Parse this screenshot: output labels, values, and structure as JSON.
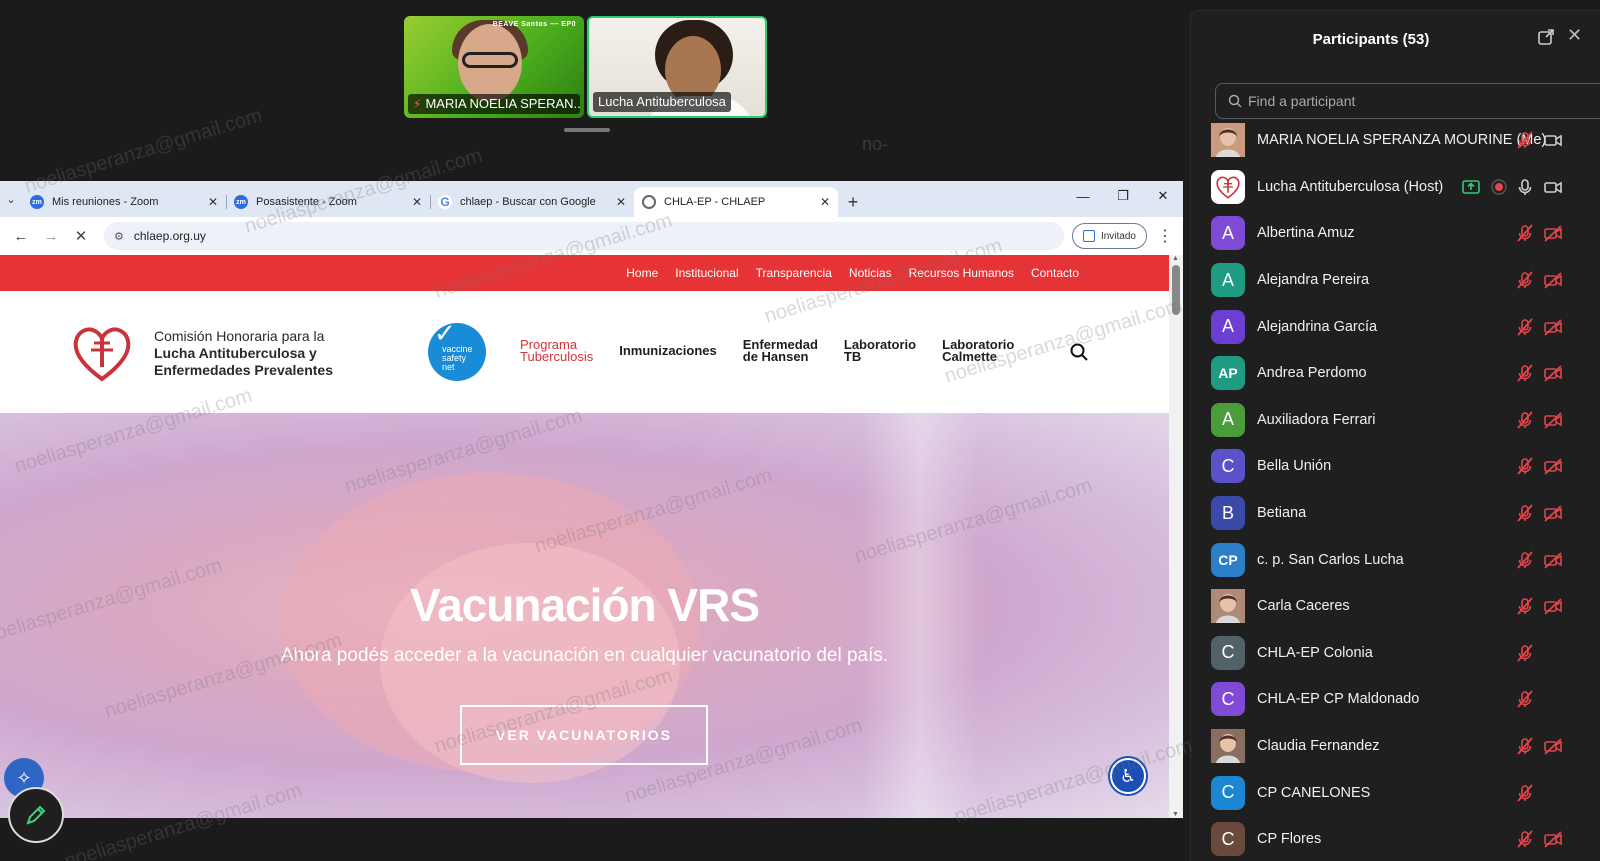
{
  "video_strip": {
    "tiles": [
      {
        "name": "MARIA NOELIA SPERAN...",
        "muted": true,
        "banner": "BEAVE Santos ‒‒ EP0"
      },
      {
        "name": "Lucha Antituberculosa",
        "muted": false
      }
    ]
  },
  "ghost_text": "no-",
  "browser": {
    "tabs": [
      {
        "title": "Mis reuniones - Zoom",
        "icon": "zoom-icon",
        "active": false
      },
      {
        "title": "Posasistente - Zoom",
        "icon": "zoom-icon",
        "active": false
      },
      {
        "title": "chlaep - Buscar con Google",
        "icon": "google-icon",
        "active": false
      },
      {
        "title": "CHLA-EP - CHLAEP",
        "icon": "site-icon",
        "active": true
      }
    ],
    "url": "chlaep.org.uy",
    "profile_label": "Invitado"
  },
  "site": {
    "topbar_links": [
      "Home",
      "Institucional",
      "Transparencia",
      "Noticias",
      "Recursos Humanos",
      "Contacto"
    ],
    "org_line1": "Comisión Honoraria para la",
    "org_line2": "Lucha Antituberculosa y",
    "org_line3": "Enfermedades Prevalentes",
    "vsn_badge": [
      "vaccine",
      "safety",
      "net"
    ],
    "nav": [
      {
        "label_1": "Programa",
        "label_2": "Tuberculosis",
        "highlight": true
      },
      {
        "label_1": "Inmunizaciones",
        "label_2": "",
        "highlight": false
      },
      {
        "label_1": "Enfermedad",
        "label_2": "de Hansen",
        "highlight": false
      },
      {
        "label_1": "Laboratorio",
        "label_2": "TB",
        "highlight": false
      },
      {
        "label_1": "Laboratorio",
        "label_2": "Calmette",
        "highlight": false
      }
    ],
    "hero": {
      "title": "Vacunación VRS",
      "subtitle": "Ahora podés acceder a la vacunación en cualquier vacunatorio del país.",
      "button": "VER VACUNATORIOS"
    }
  },
  "watermark": "noeliasperanza@gmail.com",
  "participants": {
    "title": "Participants (53)",
    "search_placeholder": "Find a participant",
    "list": [
      {
        "name": "MARIA NOELIA SPERANZA MOURINE (Me)",
        "initials": "",
        "color": "#c99a7e",
        "photo": true,
        "mic": "off",
        "video": "on",
        "share": false,
        "rec": false
      },
      {
        "name": "Lucha Antituberculosa (Host)",
        "initials": "",
        "color": "#ffffff",
        "photo": "logo",
        "mic": "on",
        "video": "on",
        "share": true,
        "rec": true
      },
      {
        "name": "Albertina Amuz",
        "initials": "A",
        "color": "#7f4bd6",
        "mic": "off",
        "video": "off"
      },
      {
        "name": "Alejandra Pereira",
        "initials": "A",
        "color": "#1f9b83",
        "mic": "off",
        "video": "off"
      },
      {
        "name": "Alejandrina García",
        "initials": "A",
        "color": "#6a3fd1",
        "mic": "off",
        "video": "off"
      },
      {
        "name": "Andrea Perdomo",
        "initials": "AP",
        "color": "#1f9b83",
        "mic": "off",
        "video": "off"
      },
      {
        "name": "Auxiliadora Ferrari",
        "initials": "A",
        "color": "#4a9d3a",
        "mic": "off",
        "video": "off"
      },
      {
        "name": "Bella Unión",
        "initials": "C",
        "color": "#5a52c8",
        "mic": "off",
        "video": "off"
      },
      {
        "name": "Betiana",
        "initials": "B",
        "color": "#3b4aa8",
        "mic": "off",
        "video": "off"
      },
      {
        "name": "c. p. San Carlos Lucha",
        "initials": "CP",
        "color": "#2a7fc8",
        "mic": "off",
        "video": "off"
      },
      {
        "name": "Carla Caceres",
        "initials": "",
        "color": "#b08a78",
        "photo": true,
        "mic": "off",
        "video": "off"
      },
      {
        "name": "CHLA-EP Colonia",
        "initials": "C",
        "color": "#536269",
        "mic": "off",
        "video": "none"
      },
      {
        "name": "CHLA-EP CP Maldonado",
        "initials": "C",
        "color": "#7f4bd6",
        "mic": "off",
        "video": "none"
      },
      {
        "name": "Claudia Fernandez",
        "initials": "",
        "color": "#8a6e62",
        "photo": true,
        "mic": "off",
        "video": "off"
      },
      {
        "name": "CP CANELONES",
        "initials": "C",
        "color": "#1b86d1",
        "mic": "off",
        "video": "none"
      },
      {
        "name": "CP Flores",
        "initials": "C",
        "color": "#6b4a3e",
        "mic": "off",
        "video": "off"
      }
    ]
  }
}
